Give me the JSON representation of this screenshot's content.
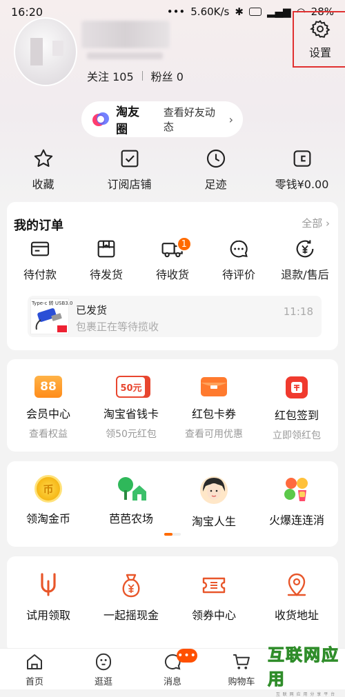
{
  "status": {
    "time": "16:20",
    "dots": "•••",
    "network": "5.60K/s",
    "battery": "28%"
  },
  "profile": {
    "follow_label": "关注",
    "follow_count": "105",
    "fans_label": "粉丝",
    "fans_count": "0"
  },
  "settings": {
    "label": "设置",
    "highlight_color": "#e03030"
  },
  "circle": {
    "name": "淘友圈",
    "action": "查看好友动态",
    "chevron": "›"
  },
  "quick": [
    {
      "label": "收藏",
      "icon": "star-icon"
    },
    {
      "label": "订阅店铺",
      "icon": "checkbox-icon"
    },
    {
      "label": "足迹",
      "icon": "clock-icon"
    },
    {
      "label": "零钱¥0.00",
      "icon": "wallet-icon"
    }
  ],
  "orders": {
    "title": "我的订单",
    "all": "全部 ›",
    "items": [
      {
        "label": "待付款",
        "icon": "card-icon"
      },
      {
        "label": "待发货",
        "icon": "package-icon"
      },
      {
        "label": "待收货",
        "icon": "truck-icon",
        "badge": "1"
      },
      {
        "label": "待评价",
        "icon": "chat-icon"
      },
      {
        "label": "退款/售后",
        "icon": "refund-icon"
      }
    ],
    "shipment": {
      "thumb_caption": "Type-c 转 USB3.0",
      "status": "已发货",
      "desc": "包裹正在等待揽收",
      "time": "11:18"
    }
  },
  "services": [
    {
      "label": "会员中心",
      "sub": "查看权益",
      "icon_text": "88"
    },
    {
      "label": "淘宝省钱卡",
      "sub": "领50元红包",
      "icon_text": "50元"
    },
    {
      "label": "红包卡券",
      "sub": "查看可用优惠",
      "icon_text": ""
    },
    {
      "label": "红包签到",
      "sub": "立即领红包",
      "icon_text": ""
    }
  ],
  "games": [
    {
      "label": "领淘金币",
      "icon": "gold-coin-icon",
      "icon_text": "币"
    },
    {
      "label": "芭芭农场",
      "icon": "farm-icon"
    },
    {
      "label": "淘宝人生",
      "icon": "avatar-girl-icon"
    },
    {
      "label": "火爆连连消",
      "icon": "fruit-icon"
    }
  ],
  "tools": [
    {
      "label": "试用领取",
      "icon": "trial-icon"
    },
    {
      "label": "一起摇现金",
      "icon": "money-bag-icon"
    },
    {
      "label": "领券中心",
      "icon": "coupon-icon"
    },
    {
      "label": "收货地址",
      "icon": "location-icon"
    }
  ],
  "tabbar": [
    {
      "label": "首页",
      "icon": "home-icon"
    },
    {
      "label": "逛逛",
      "icon": "explore-icon"
    },
    {
      "label": "消息",
      "icon": "message-icon",
      "badge": "•••"
    },
    {
      "label": "购物车",
      "icon": "cart-icon"
    }
  ],
  "watermark": {
    "main": "互联网应用",
    "small": "互 联 网 应 用 分 享 平 台"
  },
  "colors": {
    "accent": "#ff6a00",
    "icon_orange": "#e8562a"
  }
}
